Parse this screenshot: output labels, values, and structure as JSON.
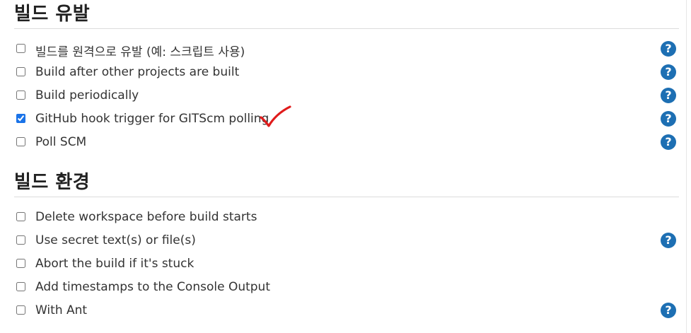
{
  "sections": [
    {
      "title": "빌드 유발",
      "items": [
        {
          "label": "빌드를 원격으로 유발 (예: 스크립트 사용)",
          "checked": false,
          "help": "?"
        },
        {
          "label": "Build after other projects are built",
          "checked": false,
          "help": "?"
        },
        {
          "label": "Build periodically",
          "checked": false,
          "help": "?"
        },
        {
          "label": "GitHub hook trigger for GITScm polling",
          "checked": true,
          "help": "?"
        },
        {
          "label": "Poll SCM",
          "checked": false,
          "help": "?"
        }
      ]
    },
    {
      "title": "빌드 환경",
      "items": [
        {
          "label": "Delete workspace before build starts",
          "checked": false,
          "help": ""
        },
        {
          "label": "Use secret text(s) or file(s)",
          "checked": false,
          "help": "?"
        },
        {
          "label": "Abort the build if it's stuck",
          "checked": false,
          "help": ""
        },
        {
          "label": "Add timestamps to the Console Output",
          "checked": false,
          "help": ""
        },
        {
          "label": "With Ant",
          "checked": false,
          "help": "?"
        }
      ]
    }
  ],
  "colors": {
    "help_icon": "#1d6fb3",
    "annotation": "#e01b1b"
  }
}
